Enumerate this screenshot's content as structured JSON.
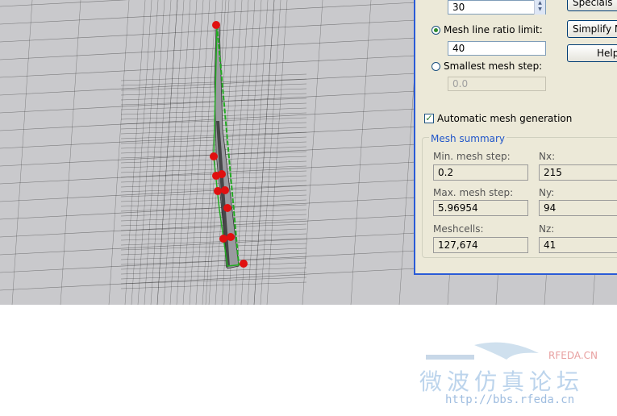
{
  "mesh": {
    "lines_per_wavelength_value": "30",
    "ratio_limit_label": "Mesh line ratio limit:",
    "ratio_limit_value": "40",
    "smallest_step_label": "Smallest mesh step:",
    "smallest_step_value": "0.0",
    "auto_label": "Automatic mesh generation"
  },
  "buttons": {
    "specials": "Specials",
    "simplify": "Simplify Mo",
    "help": "Help"
  },
  "summary": {
    "title": "Mesh summary",
    "min_label": "Min. mesh step:",
    "min_value": "0.2",
    "max_label": "Max. mesh step:",
    "max_value": "5.96954",
    "cells_label": "Meshcells:",
    "cells_value": "127,674",
    "nx_label": "Nx:",
    "nx_value": "215",
    "ny_label": "Ny:",
    "ny_value": "94",
    "nz_label": "Nz:",
    "nz_value": "41"
  },
  "watermark": {
    "brand": "RFEDA.CN",
    "title": "微波仿真论坛",
    "url": "http://bbs.rfeda.cn"
  },
  "colors": {
    "dialog_border": "#2a5bd7",
    "group_title": "#2156c9",
    "mesh_line": "#111111",
    "model_green": "#22aa22",
    "marker_red": "#e01010"
  }
}
